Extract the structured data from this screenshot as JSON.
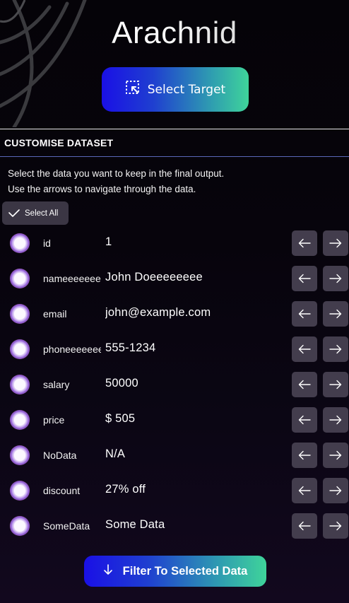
{
  "app": {
    "title": "Arachnid"
  },
  "header": {
    "select_target_label": "Select Target"
  },
  "section": {
    "title": "CUSTOMISE DATASET",
    "instruction_1": "Select the data you want to keep in the final output.",
    "instruction_2": "Use the arrows to navigate through the data.",
    "select_all_label": "Select All"
  },
  "rows": [
    {
      "key": "id",
      "value": "1"
    },
    {
      "key": "nameeeeeeeeee",
      "value": "John Doeeeeeeee"
    },
    {
      "key": "email",
      "value": "john@example.com"
    },
    {
      "key": "phoneeeeeeee",
      "value": "555-1234"
    },
    {
      "key": "salary",
      "value": "50000"
    },
    {
      "key": "price",
      "value": "$ 505"
    },
    {
      "key": "NoData",
      "value": "N/A"
    },
    {
      "key": "discount",
      "value": "27% off"
    },
    {
      "key": "SomeData",
      "value": "Some Data"
    }
  ],
  "footer": {
    "filter_label": "Filter To Selected Data"
  },
  "colors": {
    "gradient_start": "#1a10e6",
    "gradient_end": "#3fd49a",
    "arrow_button_bg": "#433d4d",
    "background": "#07040c"
  },
  "icons": {
    "select_target": "select-target-icon",
    "select_all": "checkmark-icon",
    "row_prev": "arrow-left-icon",
    "row_next": "arrow-right-icon",
    "filter": "arrow-down-icon"
  }
}
